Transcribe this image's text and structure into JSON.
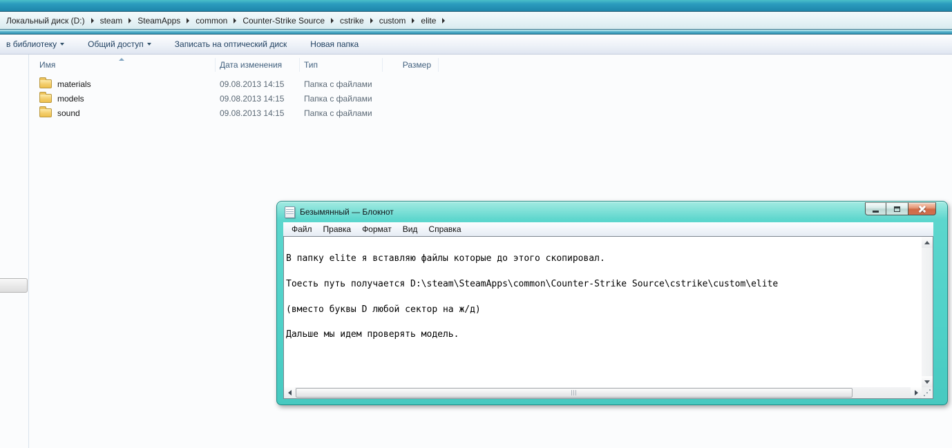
{
  "explorer": {
    "breadcrumb": {
      "items": [
        "Локальный диск (D:)",
        "steam",
        "SteamApps",
        "common",
        "Counter-Strike Source",
        "cstrike",
        "custom",
        "elite"
      ]
    },
    "toolbar": {
      "items": [
        "в библиотеку",
        "Общий доступ",
        "Записать на оптический диск",
        "Новая папка"
      ]
    },
    "list": {
      "columns": [
        "Имя",
        "Дата изменения",
        "Тип",
        "Размер"
      ],
      "rows": [
        {
          "name": "materials",
          "date": "09.08.2013 14:15",
          "type": "Папка с файлами",
          "size": ""
        },
        {
          "name": "models",
          "date": "09.08.2013 14:15",
          "type": "Папка с файлами",
          "size": ""
        },
        {
          "name": "sound",
          "date": "09.08.2013 14:15",
          "type": "Папка с файлами",
          "size": ""
        }
      ]
    }
  },
  "notepad": {
    "title": "Безымянный — Блокнот",
    "menu": [
      "Файл",
      "Правка",
      "Формат",
      "Вид",
      "Справка"
    ],
    "text_lines": [
      "В папку elite я вставляю файлы которые до этого скопировал.",
      "Тоесть путь получается D:\\steam\\SteamApps\\common\\Counter-Strike Source\\cstrike\\custom\\elite",
      "(вместо буквы D любой сектор на ж/д)",
      "Дальше мы идем проверять модель."
    ]
  },
  "colors": {
    "explorer_band_blue": "#2593b5",
    "explorer_teal_strip": "#3fa3c1",
    "toolbar_text": "#1c3d5e",
    "notepad_frame_teal": "#4fd1c8",
    "close_button_red": "#d06a45",
    "folder_yellow": "#f3cd6a"
  }
}
